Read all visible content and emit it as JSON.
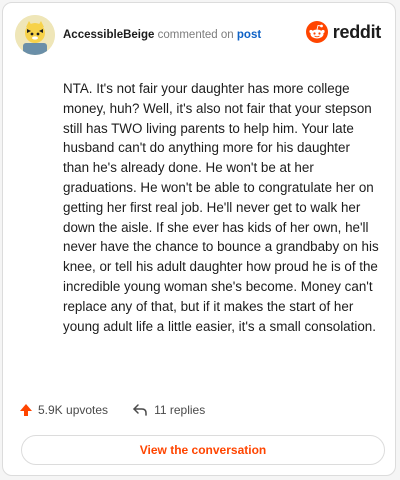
{
  "header": {
    "username": "AccessibleBeige",
    "action_text": "commented on",
    "post_link": "post"
  },
  "brand": {
    "logo_text": "reddit",
    "accent_color": "#ff4500"
  },
  "comment": {
    "body": "NTA. It's not fair your daughter has more college money, huh? Well, it's also not fair that your stepson still has TWO living parents to help him. Your late husband can't do anything more for his daughter than he's already done. He won't be at her graduations. He won't be able to congratulate her on getting her first real job. He'll never get to walk her down the aisle. If she ever has kids of her own, he'll never have the chance to bounce a grandbaby on his knee, or tell his adult daughter how proud he is of the incredible young woman she's become. Money can't replace any of that, but if it makes the start of her young adult life a little easier, it's a small consolation."
  },
  "actions": {
    "upvotes": "5.9K upvotes",
    "replies": "11 replies"
  },
  "cta": {
    "label": "View the conversation"
  },
  "icons": [
    "avatar-icon",
    "reddit-logo-icon",
    "upvote-arrow-icon",
    "reply-arrow-icon"
  ]
}
